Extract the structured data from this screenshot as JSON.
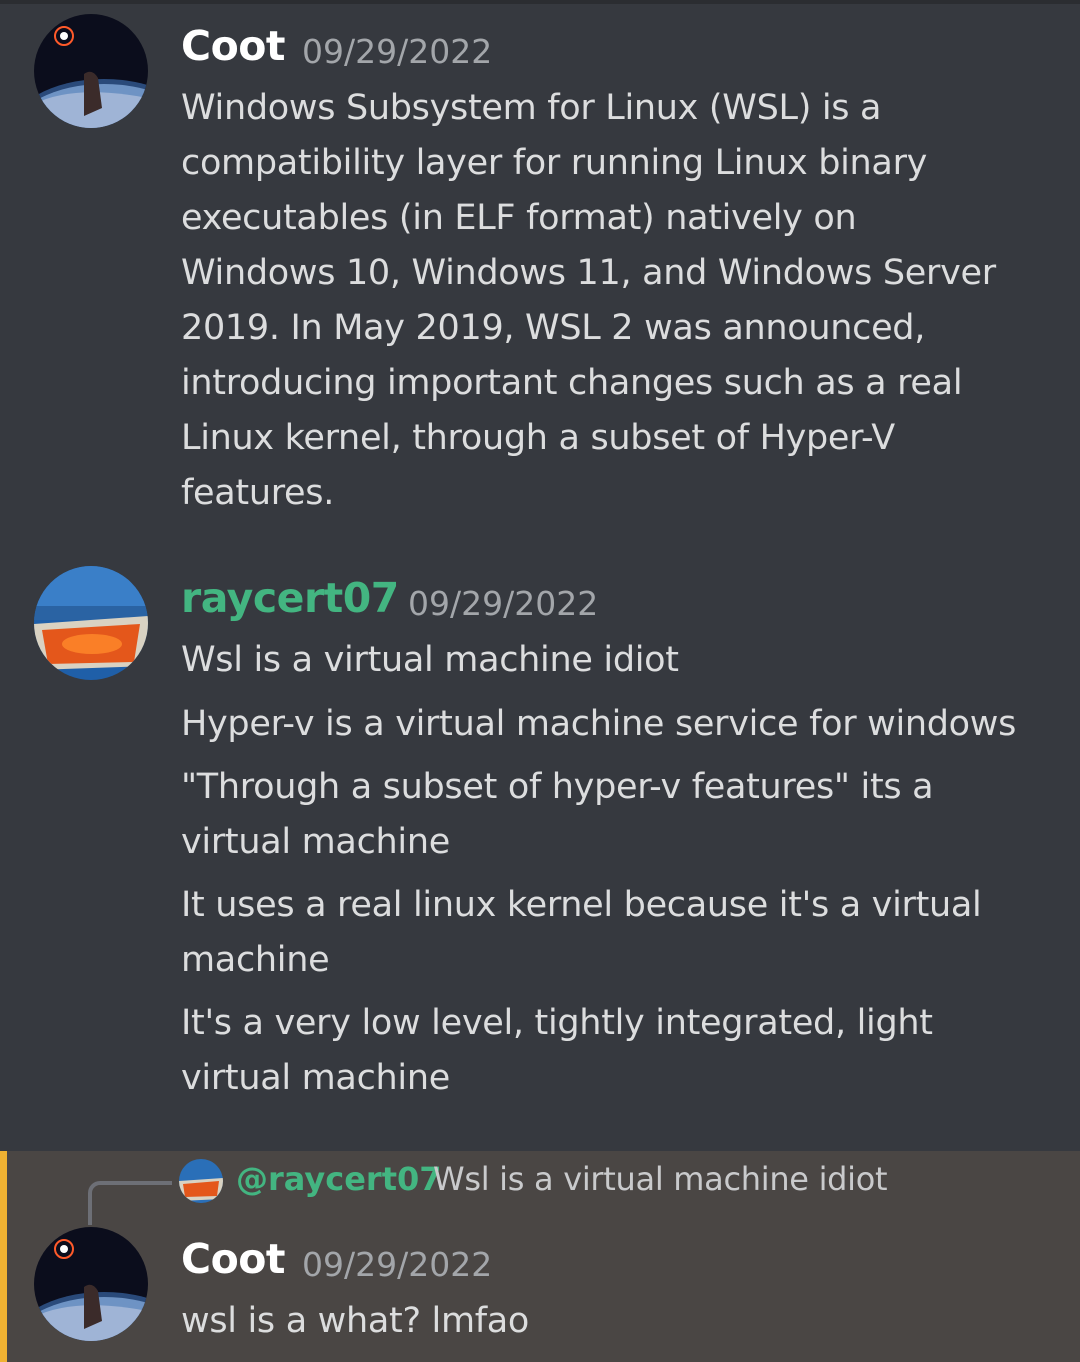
{
  "messages": [
    {
      "author": "Coot",
      "author_color": "#ffffff",
      "timestamp": "09/29/2022",
      "lines": [
        "Windows Subsystem for Linux (WSL) is a",
        "compatibility layer for running Linux binary",
        "executables (in ELF format) natively on",
        "Windows 10, Windows 11, and Windows Server",
        "2019. In May 2019, WSL 2 was announced,",
        "introducing important changes such as a real",
        "Linux kernel, through a subset of Hyper-V",
        "features."
      ]
    },
    {
      "author": "raycert07",
      "author_color": "#43b581",
      "timestamp": "09/29/2022",
      "lines": [
        "Wsl is a virtual machine idiot",
        "Hyper-v is a virtual machine service for windows",
        "\"Through a subset of hyper-v features\" its a",
        "virtual machine",
        "It uses a real linux kernel because it's a virtual",
        "machine",
        "It's a very low level, tightly integrated, light",
        "virtual machine"
      ]
    },
    {
      "author": "Coot",
      "author_color": "#ffffff",
      "timestamp": "09/29/2022",
      "reply": {
        "mention": "@raycert07",
        "snippet": "Wsl is a virtual machine idiot"
      },
      "lines": [
        "wsl is a what? lmfao"
      ]
    }
  ],
  "colors": {
    "background": "#36393f",
    "highlight_band": "#4a4644",
    "highlight_bar": "#f0b232",
    "mention": "#43b581",
    "timestamp": "#a3a6aa"
  }
}
